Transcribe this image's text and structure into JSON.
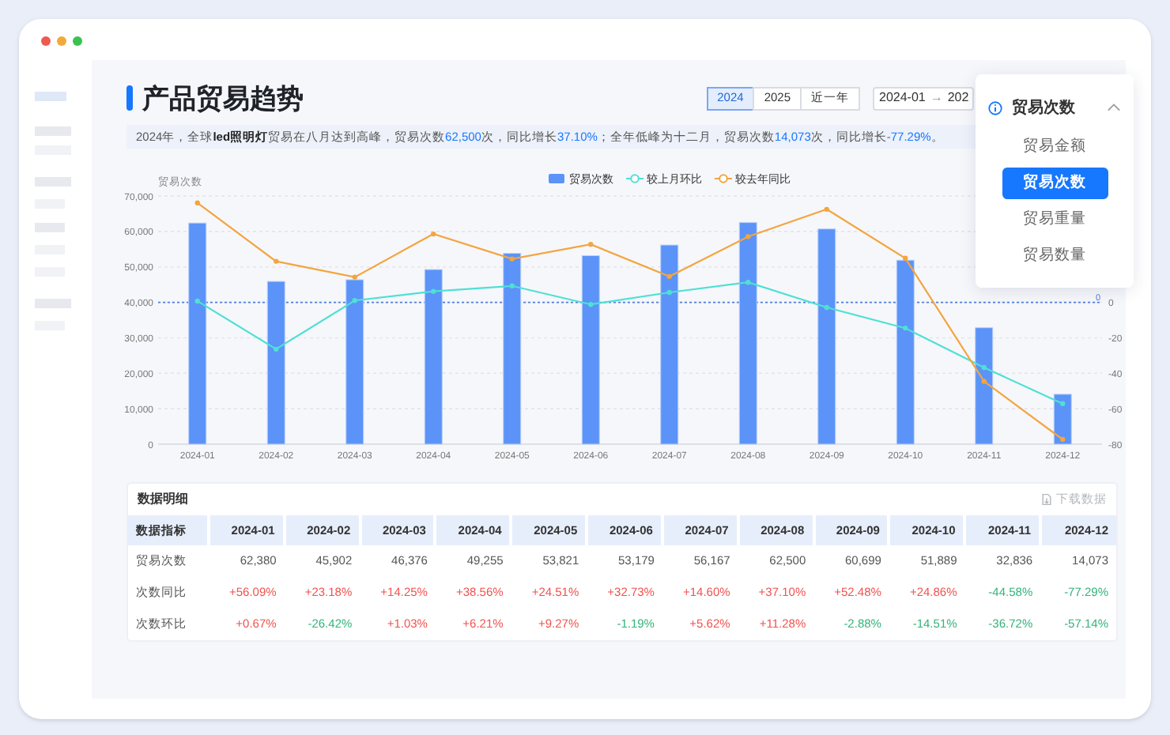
{
  "window": {
    "controls": [
      {
        "color": "#ee5a52"
      },
      {
        "color": "#f3a93a"
      },
      {
        "color": "#3cc150"
      }
    ]
  },
  "header": {
    "title": "产品贸易趋势",
    "periods": [
      {
        "label": "2024",
        "selected": true
      },
      {
        "label": "2025",
        "selected": false
      },
      {
        "label": "近一年",
        "selected": false
      }
    ],
    "date_range": {
      "start": "2024-01",
      "separator": "→",
      "end": "202"
    }
  },
  "summary": [
    {
      "text": "2024年，全球",
      "kind": "plain"
    },
    {
      "text": "led照明灯",
      "kind": "bold"
    },
    {
      "text": "贸易在八月达到高峰，贸易次数",
      "kind": "plain"
    },
    {
      "text": "62,500",
      "kind": "highlight"
    },
    {
      "text": "次，同比增长",
      "kind": "plain"
    },
    {
      "text": "37.10%",
      "kind": "highlight"
    },
    {
      "text": "；全年低峰为十二月，贸易次数",
      "kind": "plain"
    },
    {
      "text": "14,073",
      "kind": "highlight"
    },
    {
      "text": "次，同比增长",
      "kind": "plain"
    },
    {
      "text": "-77.29%",
      "kind": "highlight"
    },
    {
      "text": "。",
      "kind": "plain"
    }
  ],
  "metric_dropdown": {
    "value": "贸易次数",
    "expanded": true,
    "options": [
      {
        "label": "贸易金额",
        "selected": false
      },
      {
        "label": "贸易次数",
        "selected": true
      },
      {
        "label": "贸易重量",
        "selected": false
      },
      {
        "label": "贸易数量",
        "selected": false
      }
    ]
  },
  "chart": {
    "chart_data": {
      "type": "bar",
      "ylabel": "贸易次数",
      "categories": [
        "2024-01",
        "2024-02",
        "2024-03",
        "2024-04",
        "2024-05",
        "2024-06",
        "2024-07",
        "2024-08",
        "2024-09",
        "2024-10",
        "2024-11",
        "2024-12"
      ],
      "series": [
        {
          "name": "贸易次数",
          "color": "#5b93f8",
          "values": [
            62380,
            45902,
            46376,
            49255,
            53821,
            53179,
            56167,
            62500,
            60699,
            51889,
            32836,
            14073
          ]
        },
        {
          "name": "较上月环比",
          "type": "line",
          "axis": "y2",
          "marker": "circle",
          "color": "#4ee0d4",
          "values": [
            0.67,
            -26.42,
            1.03,
            6.21,
            9.27,
            -1.19,
            5.62,
            11.28,
            -2.88,
            -14.51,
            -36.72,
            -57.14
          ]
        },
        {
          "name": "较去年同比",
          "type": "line",
          "axis": "y2",
          "marker": "circle",
          "color": "#f3a53f",
          "values": [
            56.09,
            23.18,
            14.25,
            38.56,
            24.51,
            32.73,
            14.6,
            37.1,
            52.48,
            24.86,
            -44.58,
            -77.29
          ]
        }
      ],
      "ylim": [
        0,
        70000
      ],
      "yticks": [
        {
          "value": 0,
          "label": "0"
        },
        {
          "value": 10000,
          "label": "10,000"
        },
        {
          "value": 20000,
          "label": "20,000"
        },
        {
          "value": 30000,
          "label": "30,000"
        },
        {
          "value": 40000,
          "label": "40,000"
        },
        {
          "value": 50000,
          "label": "50,000"
        },
        {
          "value": 60000,
          "label": "60,000"
        },
        {
          "value": 70000,
          "label": "70,000"
        }
      ],
      "y2lim": [
        -80,
        60
      ],
      "y2ticks": [
        0,
        -20,
        -40,
        -60,
        -80
      ],
      "grid": true,
      "legend": true,
      "ref_lines": [
        {
          "axis": "y2",
          "value": 0,
          "label": "0"
        }
      ]
    }
  },
  "table": {
    "title": "数据明细",
    "download": {
      "label": "下载数据",
      "disabled": true
    },
    "columns": [
      "数据指标",
      "2024-01",
      "2024-02",
      "2024-03",
      "2024-04",
      "2024-05",
      "2024-06",
      "2024-07",
      "2024-08",
      "2024-09",
      "2024-10",
      "2024-11",
      "2024-12"
    ],
    "rows": [
      {
        "cells": [
          {
            "text": "贸易次数"
          },
          {
            "text": "62,380"
          },
          {
            "text": "45,902"
          },
          {
            "text": "46,376"
          },
          {
            "text": "49,255"
          },
          {
            "text": "53,821"
          },
          {
            "text": "53,179"
          },
          {
            "text": "56,167"
          },
          {
            "text": "62,500"
          },
          {
            "text": "60,699"
          },
          {
            "text": "51,889"
          },
          {
            "text": "32,836"
          },
          {
            "text": "14,073"
          }
        ]
      },
      {
        "cells": [
          {
            "text": "次数同比"
          },
          {
            "text": "+56.09%",
            "color": "#f0524f"
          },
          {
            "text": "+23.18%",
            "color": "#f0524f"
          },
          {
            "text": "+14.25%",
            "color": "#f0524f"
          },
          {
            "text": "+38.56%",
            "color": "#f0524f"
          },
          {
            "text": "+24.51%",
            "color": "#f0524f"
          },
          {
            "text": "+32.73%",
            "color": "#f0524f"
          },
          {
            "text": "+14.60%",
            "color": "#f0524f"
          },
          {
            "text": "+37.10%",
            "color": "#f0524f"
          },
          {
            "text": "+52.48%",
            "color": "#f0524f"
          },
          {
            "text": "+24.86%",
            "color": "#f0524f"
          },
          {
            "text": "-44.58%",
            "color": "#34b37a"
          },
          {
            "text": "-77.29%",
            "color": "#34b37a"
          }
        ]
      },
      {
        "cells": [
          {
            "text": "次数环比"
          },
          {
            "text": "+0.67%",
            "color": "#f0524f"
          },
          {
            "text": "-26.42%",
            "color": "#34b37a"
          },
          {
            "text": "+1.03%",
            "color": "#f0524f"
          },
          {
            "text": "+6.21%",
            "color": "#f0524f"
          },
          {
            "text": "+9.27%",
            "color": "#f0524f"
          },
          {
            "text": "-1.19%",
            "color": "#34b37a"
          },
          {
            "text": "+5.62%",
            "color": "#f0524f"
          },
          {
            "text": "+11.28%",
            "color": "#f0524f"
          },
          {
            "text": "-2.88%",
            "color": "#34b37a"
          },
          {
            "text": "-14.51%",
            "color": "#34b37a"
          },
          {
            "text": "-36.72%",
            "color": "#34b37a"
          },
          {
            "text": "-57.14%",
            "color": "#34b37a"
          }
        ]
      }
    ]
  }
}
